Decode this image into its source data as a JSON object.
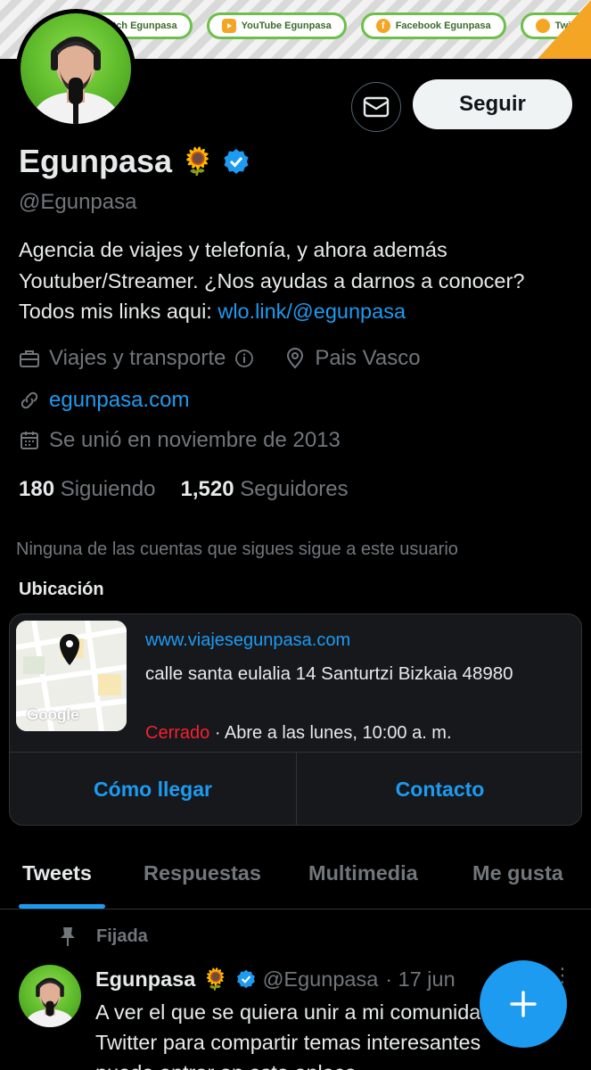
{
  "banner": {
    "links": [
      {
        "label": "Twitch Egunpasa",
        "icon": "twitch-icon",
        "color": "#9146ff"
      },
      {
        "label": "YouTube Egunpasa",
        "icon": "youtube-icon",
        "color": "#ff0000"
      },
      {
        "label": "Facebook Egunpasa",
        "icon": "facebook-icon",
        "color": "#f5a524"
      },
      {
        "label": "Twitter Egunpasa",
        "icon": "twitter-icon",
        "color": "#f5a524"
      }
    ]
  },
  "profile": {
    "follow_label": "Seguir",
    "name": "Egunpasa",
    "emoji": "🌻",
    "handle": "@Egunpasa",
    "bio_text": "Agencia de viajes y telefonía, y ahora además Youtuber/Streamer. ¿Nos ayudas a darnos a conocer? Todos mis links aqui: ",
    "bio_link": "wlo.link/@egunpasa",
    "category": "Viajes y transporte",
    "location": "Pais Vasco",
    "website": "egunpasa.com",
    "joined": "Se unió en noviembre de 2013",
    "following_count": "180",
    "following_label": "Siguiendo",
    "followers_count": "1,520",
    "followers_label": "Seguidores",
    "no_mutuals": "Ninguna de las cuentas que sigues sigue a este usuario"
  },
  "location_card": {
    "title": "Ubicación",
    "map_label": "Google",
    "url": "www.viajesegunpasa.com",
    "address": "calle santa eulalia 14 Santurtzi Bizkaia 48980",
    "status": "Cerrado",
    "hours": " · Abre a las lunes, 10:00 a. m.",
    "directions_label": "Cómo llegar",
    "contact_label": "Contacto"
  },
  "tabs": [
    "Tweets",
    "Respuestas",
    "Multimedia",
    "Me gusta"
  ],
  "pinned_tweet": {
    "pinned_label": "Fijada",
    "name": "Egunpasa",
    "emoji": "🌻",
    "handle": "@Egunpasa",
    "date": "· 17 jun",
    "lines": [
      "A ver el que se quiera unir a mi comunidad en",
      "Twitter para compartir temas interesantes",
      "puede entrar en este enlace"
    ]
  },
  "colors": {
    "accent": "#1d9bf0",
    "background": "#000000",
    "muted": "#71767b",
    "closed": "#f4212e"
  }
}
